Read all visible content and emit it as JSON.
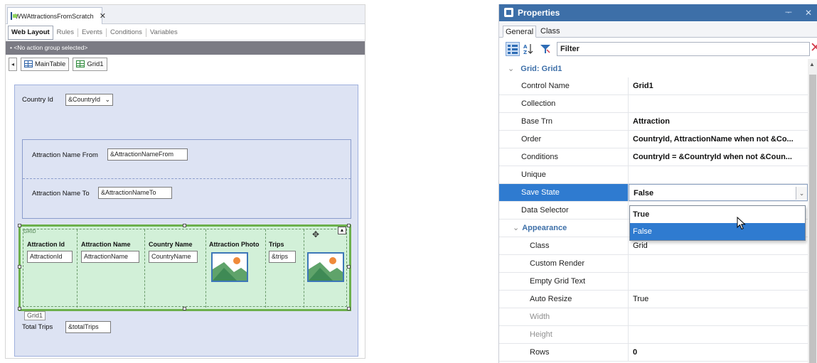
{
  "designer": {
    "tab_title": "WWAttractionsFromScratch",
    "tab_close": "✕",
    "subtabs": [
      "Web Layout",
      "Rules",
      "Events",
      "Conditions",
      "Variables"
    ],
    "action_group": "• <No action group selected>",
    "breadcrumbs": [
      "MainTable",
      "Grid1"
    ],
    "breadcrumb_arrow": "◂",
    "country_label": "Country Id",
    "country_combo": "&CountryId",
    "filter_from_label": "Attraction Name From",
    "filter_from_var": "&AttractionNameFrom",
    "filter_to_label": "Attraction Name To",
    "filter_to_var": "&AttractionNameTo",
    "grid_tag": "GRID",
    "grid_columns": [
      {
        "header": "Attraction Id",
        "value": "AttractionId"
      },
      {
        "header": "Attraction Name",
        "value": "AttractionName"
      },
      {
        "header": "Country Name",
        "value": "CountryName"
      },
      {
        "header": "Attraction Photo",
        "value": ""
      },
      {
        "header": "Trips",
        "value": "&trips"
      }
    ],
    "grid_name_tag": "Grid1",
    "total_label": "Total Trips",
    "total_var": "&totalTrips"
  },
  "properties": {
    "title": "Properties",
    "pin": "ᅮ",
    "close": "✕",
    "tabs": [
      "General",
      "Class"
    ],
    "filter_label": "Filter",
    "filter_clear": "✕",
    "section": "Grid: Grid1",
    "rows": [
      {
        "name": "Control Name",
        "value": "Grid1"
      },
      {
        "name": "Collection",
        "value": ""
      },
      {
        "name": "Base Trn",
        "value": "Attraction"
      },
      {
        "name": "Order",
        "value": "CountryId, AttractionName when not &Co..."
      },
      {
        "name": "Conditions",
        "value": "CountryId = &CountryId when not &Coun..."
      },
      {
        "name": "Unique",
        "value": ""
      },
      {
        "name": "Save State",
        "value": "False"
      },
      {
        "name": "Data Selector",
        "value": ""
      }
    ],
    "appearance_section": "Appearance",
    "appearance_rows": [
      {
        "name": "Class",
        "value": "Grid"
      },
      {
        "name": "Custom Render",
        "value": ""
      },
      {
        "name": "Empty Grid Text",
        "value": ""
      },
      {
        "name": "Auto Resize",
        "value": "True"
      },
      {
        "name": "Width",
        "value": ""
      },
      {
        "name": "Height",
        "value": ""
      },
      {
        "name": "Rows",
        "value": "0"
      }
    ],
    "dropdown_options": [
      "True",
      "False"
    ],
    "dropdown_selected": "False"
  },
  "colors": {
    "title_bar": "#3d6fa8",
    "selection": "#2f7bd0",
    "grid_fill": "#d2f0d8",
    "grid_border": "#6cb04c",
    "form_fill": "#dde3f3"
  }
}
